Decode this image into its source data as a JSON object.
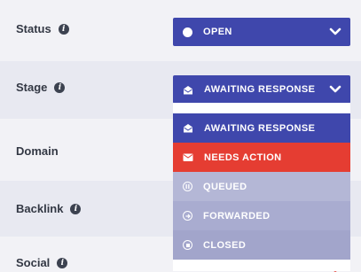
{
  "fields": {
    "status": {
      "label": "Status",
      "value": "OPEN"
    },
    "stage": {
      "label": "Stage",
      "value": "AWAITING RESPONSE"
    },
    "domain": {
      "label": "Domain"
    },
    "backlink": {
      "label": "Backlink"
    },
    "social": {
      "label": "Social"
    }
  },
  "info_glyph": "i",
  "stage_menu": {
    "options": [
      {
        "label": "AWAITING RESPONSE",
        "icon": "envelope-open-icon",
        "color": "#3f47ac"
      },
      {
        "label": "NEEDS ACTION",
        "icon": "envelope-icon",
        "color": "#e53d32"
      },
      {
        "label": "QUEUED",
        "icon": "pause-circle-icon",
        "color": "#b4b7d6"
      },
      {
        "label": "FORWARDED",
        "icon": "arrow-circle-right-icon",
        "color": "#a9acd0"
      },
      {
        "label": "CLOSED",
        "icon": "stop-circle-icon",
        "color": "#a2a5cb"
      }
    ]
  },
  "colors": {
    "accent": "#3f47ac",
    "danger": "#e53d32"
  }
}
